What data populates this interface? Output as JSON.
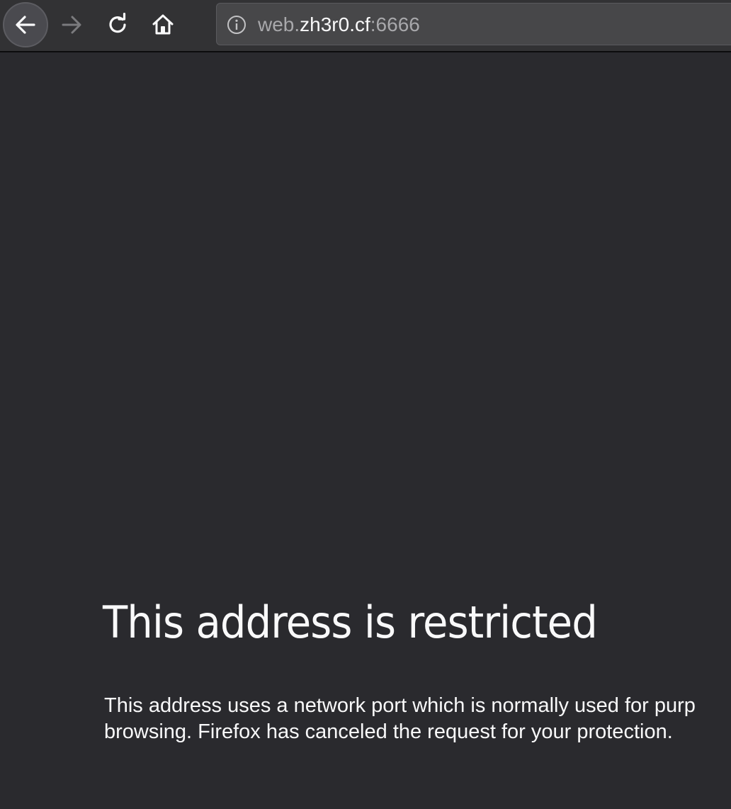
{
  "browser": {
    "url": {
      "prefix": "web.",
      "host": "zh3r0.cf",
      "port": ":6666"
    }
  },
  "icons": {
    "back": "back-arrow-icon",
    "forward": "forward-arrow-icon",
    "reload": "reload-icon",
    "home": "home-icon",
    "site_info": "info-icon"
  },
  "colors": {
    "page_background": "#2a2a2e",
    "toolbar_background": "#323234",
    "text": "#f9f9fa"
  },
  "error": {
    "title": "This address is restricted",
    "description_line1": "This address uses a network port which is normally used for purp",
    "description_line2": "browsing. Firefox has canceled the request for your protection."
  }
}
